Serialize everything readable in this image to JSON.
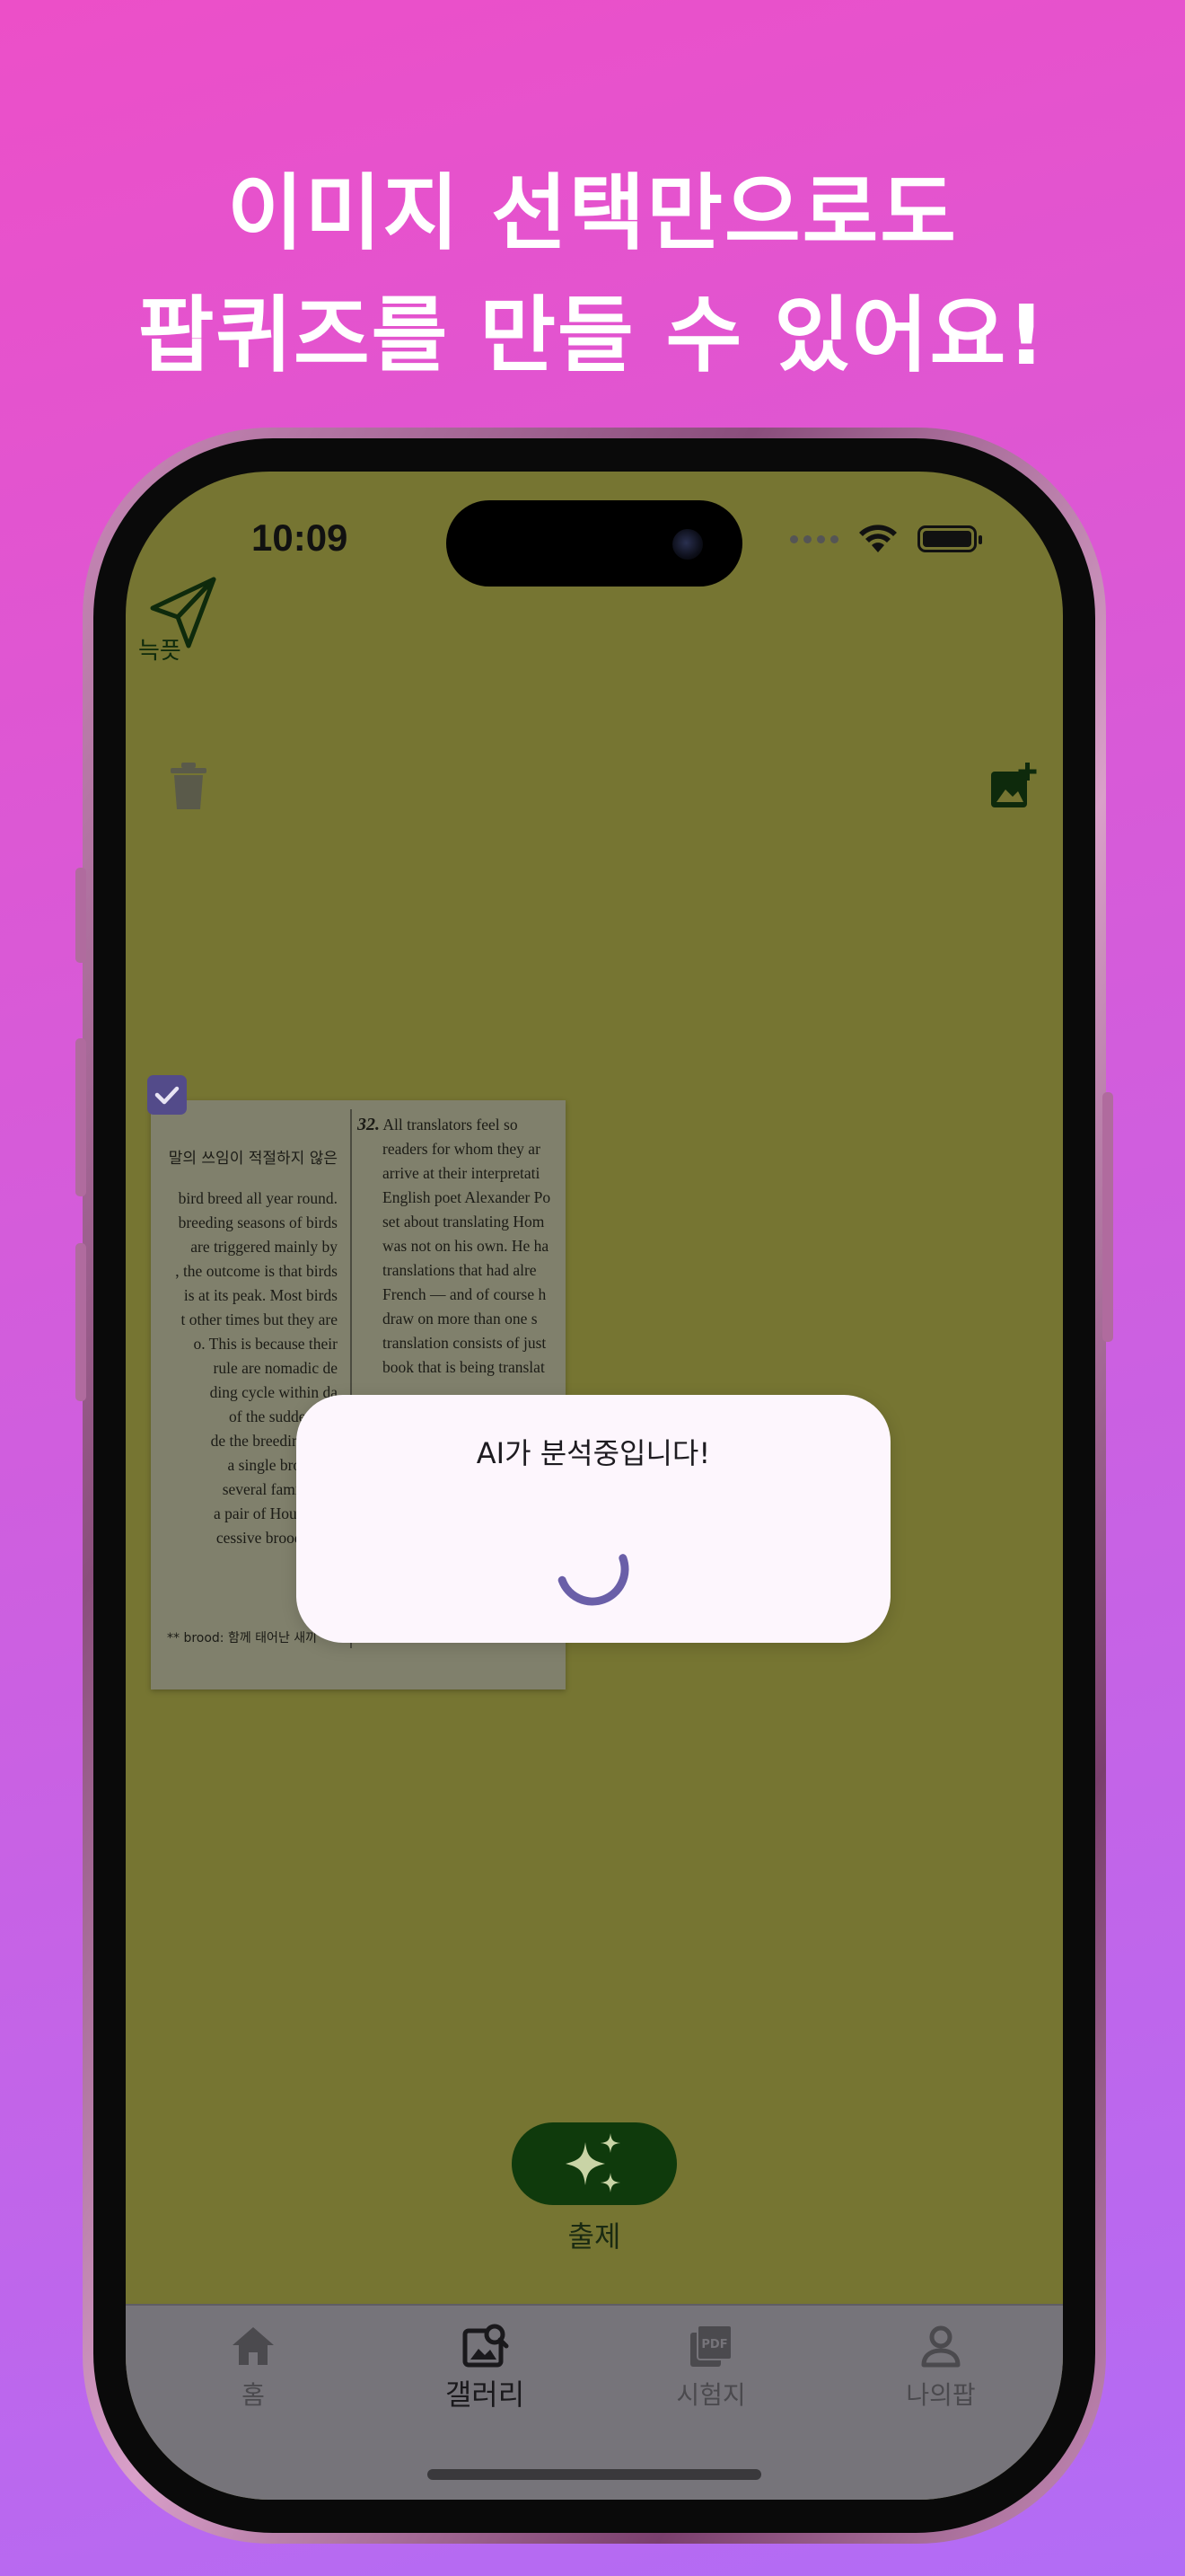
{
  "headline": {
    "line1": "이미지 선택만으로도",
    "line2": "팝퀴즈를 만들 수 있어요!"
  },
  "status_bar": {
    "time": "10:09"
  },
  "app": {
    "logo_text": "늑픗",
    "toolbar": {
      "delete_icon": "trash-icon",
      "add_image_icon": "add-photo-icon"
    },
    "gallery": {
      "selected": true,
      "thumbnail": {
        "heading_left": "말의 쓰임이 적절하지 않은",
        "left_lines": [
          "bird breed all year round.",
          "breeding seasons of birds",
          "are triggered mainly by",
          ", the outcome is that birds",
          "is at its peak. Most birds",
          "t other times but they are",
          "o. This is because their",
          "rule are nomadic de",
          "ding cycle within da",
          "of the sudden bre",
          "de the breeding seas",
          "a single brood. In",
          "several families in",
          "a pair of House Spa",
          "cessive broods thro"
        ],
        "right_number": "32.",
        "right_lines": [
          "All translators feel so",
          "readers for whom they ar",
          "arrive at their interpretati",
          "English poet Alexander Po",
          "set about translating Hom",
          "was not on his own. He ha",
          "translations that had alre",
          "French — and of course h",
          "draw on more than one s",
          "translation consists of just",
          "book that is being translat"
        ],
        "footnote": "** brood: 함께 태어난 새끼"
      }
    },
    "dialog": {
      "message": "AI가 분석중입니다!"
    },
    "fab": {
      "label": "출제",
      "icon": "sparkles-icon"
    },
    "bottom_nav": {
      "items": [
        {
          "label": "홈",
          "icon": "home-icon",
          "active": false
        },
        {
          "label": "갤러리",
          "icon": "gallery-icon",
          "active": true
        },
        {
          "label": "시험지",
          "icon": "pdf-icon",
          "active": false
        },
        {
          "label": "나의팝",
          "icon": "person-icon",
          "active": false
        }
      ]
    }
  },
  "colors": {
    "screen_overlay": "#767532",
    "accent": "#534b8a",
    "fab": "#0f3a0c",
    "dialog_bg": "#fdf6fd"
  }
}
